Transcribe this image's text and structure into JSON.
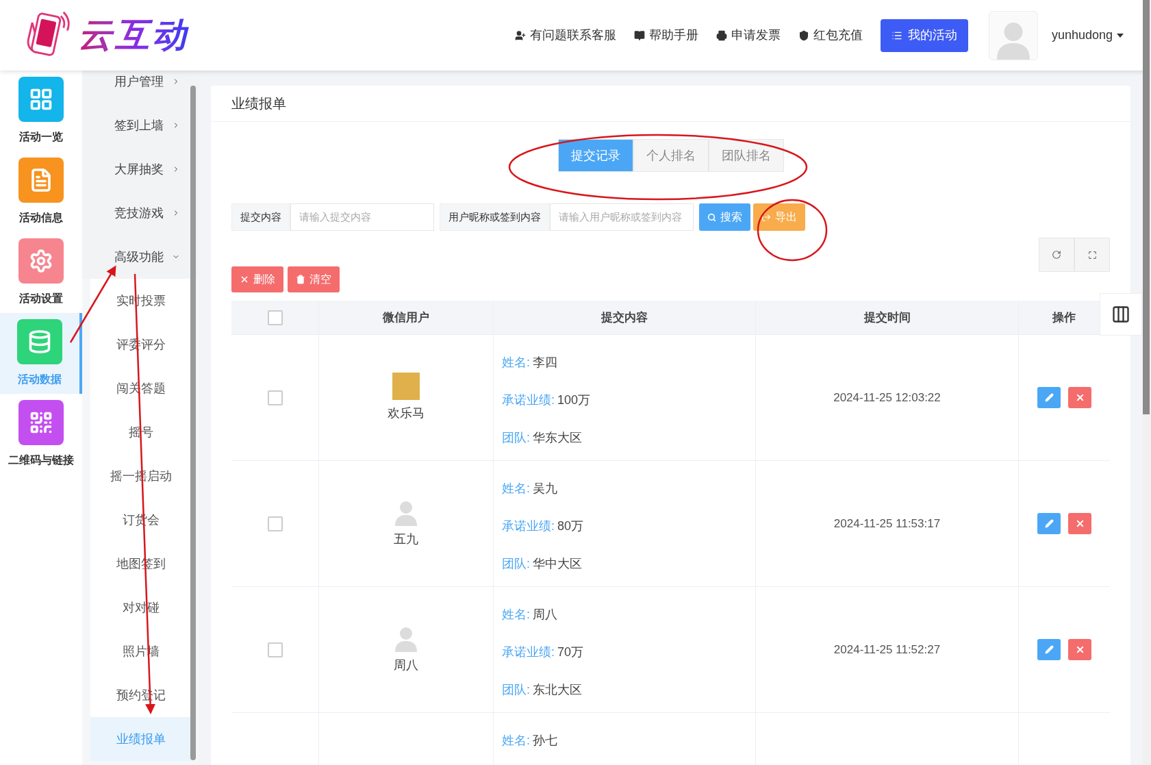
{
  "header": {
    "logo_text": "云互动",
    "links": [
      {
        "kind": "user-plus",
        "label": "有问题联系客服"
      },
      {
        "kind": "book",
        "label": "帮助手册"
      },
      {
        "kind": "printer",
        "label": "申请发票"
      },
      {
        "kind": "shield",
        "label": "红包充值"
      }
    ],
    "primary_button": "我的活动",
    "username": "yunhudong"
  },
  "nav": [
    {
      "label": "活动一览",
      "kind": "grid",
      "color": "#13b5ea",
      "selected": false
    },
    {
      "label": "活动信息",
      "kind": "doc",
      "color": "#f7931e",
      "selected": false
    },
    {
      "label": "活动设置",
      "kind": "gear",
      "color": "#f7858f",
      "selected": false
    },
    {
      "label": "活动数据",
      "kind": "database",
      "color": "#2ed47a",
      "selected": true
    },
    {
      "label": "二维码与链接",
      "kind": "qr",
      "color": "#c44ff0",
      "selected": false
    }
  ],
  "menu": [
    {
      "label": "用户管理",
      "expanded": false
    },
    {
      "label": "签到上墙",
      "expanded": false
    },
    {
      "label": "大屏抽奖",
      "expanded": false
    },
    {
      "label": "竞技游戏",
      "expanded": false
    },
    {
      "label": "高级功能",
      "expanded": true,
      "children": [
        {
          "label": "实时投票",
          "selected": false
        },
        {
          "label": "评委评分",
          "selected": false
        },
        {
          "label": "闯关答题",
          "selected": false
        },
        {
          "label": "摇号",
          "selected": false
        },
        {
          "label": "摇一摇启动",
          "selected": false
        },
        {
          "label": "订货会",
          "selected": false
        },
        {
          "label": "地图签到",
          "selected": false
        },
        {
          "label": "对对碰",
          "selected": false
        },
        {
          "label": "照片墙",
          "selected": false
        },
        {
          "label": "预约登记",
          "selected": false
        },
        {
          "label": "业绩报单",
          "selected": true
        }
      ]
    }
  ],
  "card": {
    "title": "业绩报单",
    "tabs": [
      {
        "label": "提交记录",
        "selected": true
      },
      {
        "label": "个人排名",
        "selected": false
      },
      {
        "label": "团队排名",
        "selected": false
      }
    ],
    "filters": [
      {
        "label": "提交内容",
        "placeholder": "请输入提交内容"
      },
      {
        "label": "用户昵称或签到内容",
        "placeholder": "请输入用户昵称或签到内容"
      }
    ],
    "search_button": "搜索",
    "export_button": "导出",
    "delete_button": "删除",
    "clear_button": "清空",
    "table": {
      "all_checked": false,
      "columns": [
        "微信用户",
        "提交内容",
        "提交时间",
        "操作"
      ],
      "rows": [
        {
          "checked": false,
          "has_photo": true,
          "user": "欢乐马",
          "fields": [
            {
              "label": "姓名:",
              "value": "李四"
            },
            {
              "label": "承诺业绩:",
              "value": "100万"
            },
            {
              "label": "团队:",
              "value": "华东大区"
            }
          ],
          "time": "2024-11-25 12:03:22"
        },
        {
          "checked": false,
          "has_photo": false,
          "user": "五九",
          "fields": [
            {
              "label": "姓名:",
              "value": "吴九"
            },
            {
              "label": "承诺业绩:",
              "value": "80万"
            },
            {
              "label": "团队:",
              "value": "华中大区"
            }
          ],
          "time": "2024-11-25 11:53:17"
        },
        {
          "checked": false,
          "has_photo": false,
          "user": "周八",
          "fields": [
            {
              "label": "姓名:",
              "value": "周八"
            },
            {
              "label": "承诺业绩:",
              "value": "70万"
            },
            {
              "label": "团队:",
              "value": "东北大区"
            }
          ],
          "time": "2024-11-25 11:52:27"
        },
        {
          "fields": [
            {
              "label": "姓名:",
              "value": "孙七"
            }
          ]
        }
      ]
    }
  }
}
